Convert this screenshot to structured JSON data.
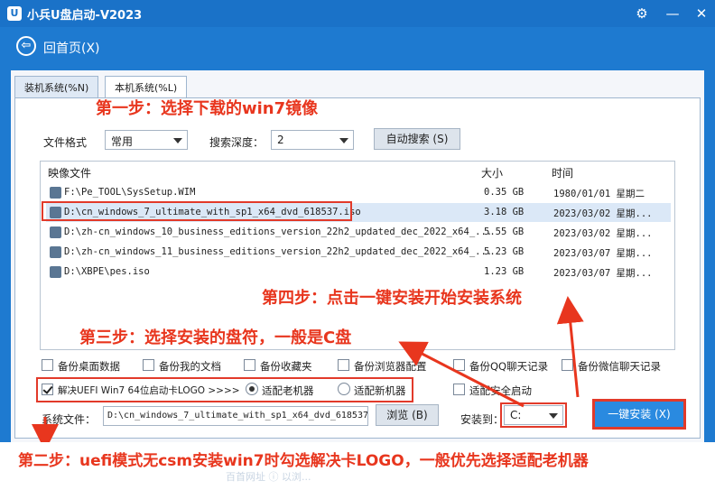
{
  "window": {
    "title": "小兵U盘启动-V2023",
    "logo_text": "U",
    "controls": {
      "settings": "⚙",
      "minimize": "—",
      "close": "✕"
    }
  },
  "nav": {
    "back_icon": "⇦",
    "back_label": "回首页(X)"
  },
  "tabs": [
    {
      "label": "装机系统(%N)",
      "active": false
    },
    {
      "label": "本机系统(%L)",
      "active": true
    }
  ],
  "filters": {
    "format_label": "文件格式",
    "format_value": "常用",
    "depth_label": "搜索深度：",
    "depth_value": "2",
    "auto_search_label": "自动搜索 (S)"
  },
  "file_list": {
    "columns": [
      "映像文件",
      "大小",
      "时间"
    ],
    "rows": [
      {
        "name": "F:\\Pe_TOOL\\SysSetup.WIM",
        "size": "0.35 GB",
        "time": "1980/01/01 星期二",
        "selected": false
      },
      {
        "name": "D:\\cn_windows_7_ultimate_with_sp1_x64_dvd_618537.iso",
        "size": "3.18 GB",
        "time": "2023/03/02 星期...",
        "selected": true
      },
      {
        "name": "D:\\zh-cn_windows_10_business_editions_version_22h2_updated_dec_2022_x64_...",
        "size": "5.55 GB",
        "time": "2023/03/02 星期...",
        "selected": false
      },
      {
        "name": "D:\\zh-cn_windows_11_business_editions_version_22h2_updated_dec_2022_x64_...",
        "size": "5.23 GB",
        "time": "2023/03/07 星期...",
        "selected": false
      },
      {
        "name": "D:\\XBPE\\pes.iso",
        "size": "1.23 GB",
        "time": "2023/03/07 星期...",
        "selected": false
      }
    ]
  },
  "backup_options": [
    {
      "label": "备份桌面数据",
      "checked": false
    },
    {
      "label": "备份我的文档",
      "checked": false
    },
    {
      "label": "备份收藏夹",
      "checked": false
    },
    {
      "label": "备份浏览器配置",
      "checked": false
    },
    {
      "label": "备份QQ聊天记录",
      "checked": false
    },
    {
      "label": "备份微信聊天记录",
      "checked": false
    }
  ],
  "boot_options": {
    "uefi_logo": {
      "label": "解决UEFI Win7 64位启动卡LOGO >>>>",
      "checked": true
    },
    "old_machine": {
      "label": "适配老机器",
      "selected": true
    },
    "new_machine": {
      "label": "适配新机器",
      "selected": false
    },
    "secure_boot": {
      "label": "适配安全启动",
      "checked": false
    }
  },
  "system_file": {
    "label": "系统文件：",
    "value": "D:\\cn_windows_7_ultimate_with_sp1_x64_dvd_618537.iso",
    "browse_label": "浏览 (B)"
  },
  "install_to": {
    "label": "安装到：",
    "value": "C:"
  },
  "install_button": "一键安装 (X)",
  "annotations": {
    "step1": "第一步：选择下载的win7镜像",
    "step2": "第二步：uefi模式无csm安装win7时勾选解决卡LOGO，一般优先选择适配老机器",
    "step3": "第三步：选择安装的盘符，一般是C盘",
    "step4": "第四步：点击一键安装开始安装系统"
  },
  "bottom_hint": "百首网址    ⓘ 以浏..."
}
